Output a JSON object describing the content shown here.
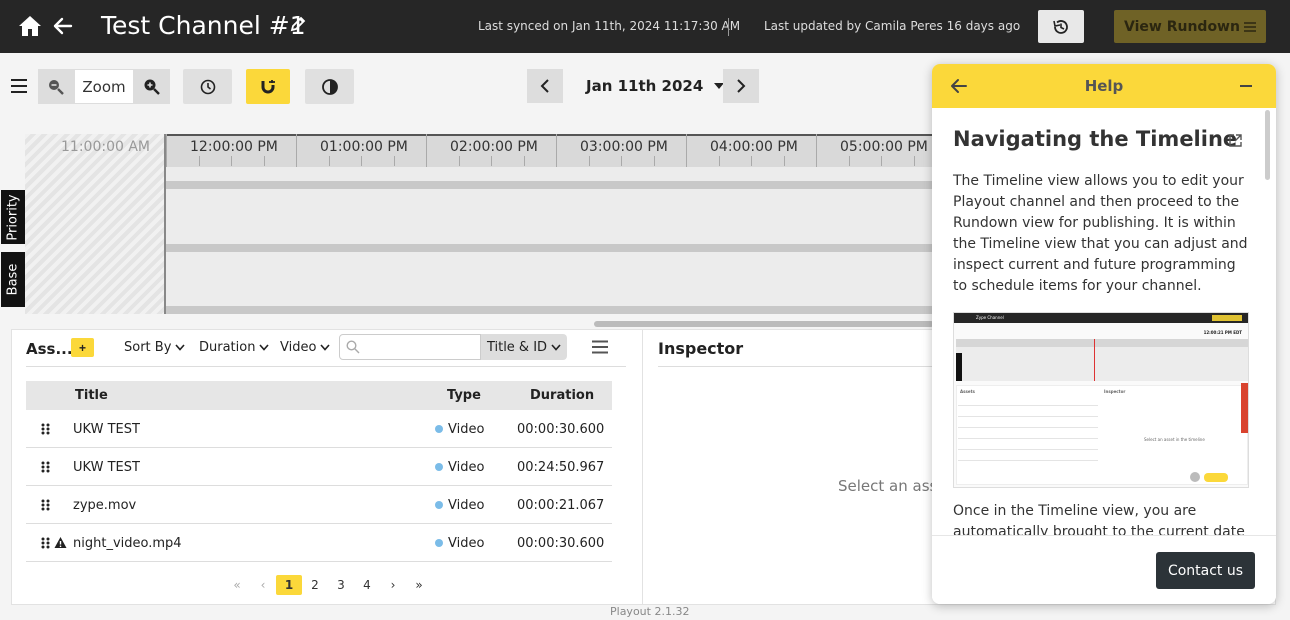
{
  "header": {
    "title": "Test Channel #1",
    "last_synced": "Last synced on Jan 11th, 2024 11:17:30 AM",
    "last_updated": "Last updated by Camila Peres 16 days ago",
    "rundown_label": "View Rundown",
    "icons": [
      "home-icon",
      "back-arrow-icon",
      "pencil-icon",
      "history-icon",
      "list-icon"
    ]
  },
  "toolbar": {
    "zoom_label": "Zoom",
    "date": "Jan 11th 2024",
    "icons": [
      "hamburger-icon",
      "zoom-out-icon",
      "zoom-in-icon",
      "clock-icon",
      "magnet-icon",
      "contrast-icon",
      "chevron-left-icon",
      "chevron-right-icon",
      "caret-down-icon"
    ]
  },
  "timeline": {
    "labels": [
      "11:00:00 AM",
      "12:00:00 PM",
      "01:00:00 PM",
      "02:00:00 PM",
      "03:00:00 PM",
      "04:00:00 PM",
      "05:00:00 PM"
    ],
    "tracks": [
      "Priority",
      "Base"
    ]
  },
  "assets": {
    "heading": "Ass...",
    "add_label": "+",
    "sort_label": "Sort By",
    "duration_label": "Duration",
    "type_label": "Video",
    "search_placeholder": "",
    "search_mode": "Title & ID",
    "columns": {
      "title": "Title",
      "type": "Type",
      "duration": "Duration"
    },
    "rows": [
      {
        "title": "UKW TEST",
        "type": "Video",
        "duration": "00:00:30.600",
        "warning": false
      },
      {
        "title": "UKW TEST",
        "type": "Video",
        "duration": "00:24:50.967",
        "warning": false
      },
      {
        "title": "zype.mov",
        "type": "Video",
        "duration": "00:00:21.067",
        "warning": false
      },
      {
        "title": "night_video.mp4",
        "type": "Video",
        "duration": "00:00:30.600",
        "warning": true
      }
    ],
    "pagination": {
      "first": "«",
      "prev": "‹",
      "pages": [
        "1",
        "2",
        "3",
        "4"
      ],
      "current": "1",
      "next": "›",
      "last": "»"
    }
  },
  "inspector": {
    "title": "Inspector",
    "empty_text": "Select an ass"
  },
  "help": {
    "bar_label": "Help",
    "heading": "Navigating the Timeline",
    "paragraph1": "The Timeline view allows you to edit your Playout channel and then proceed to the Rundown view for publishing. It is within the Timeline view that you can adjust and inspect current and future programming to schedule items for your channel.",
    "paragraph2": "Once in the Timeline view, you are automatically brought to the current date and",
    "contact_label": "Contact us",
    "thumbnail": {
      "channel_title": "Zype Channel",
      "time": "12:00:21 PM EDT",
      "assets_label": "Assets",
      "inspector_label": "Inspector",
      "inspector_empty": "Select an asset in the timeline"
    }
  },
  "footer": {
    "version": "Playout 2.1.32"
  },
  "colors": {
    "accent": "#fbd83a",
    "header_bg": "#262626",
    "rundown_btn": "#6f6226",
    "contact_btn": "#2c3338"
  }
}
